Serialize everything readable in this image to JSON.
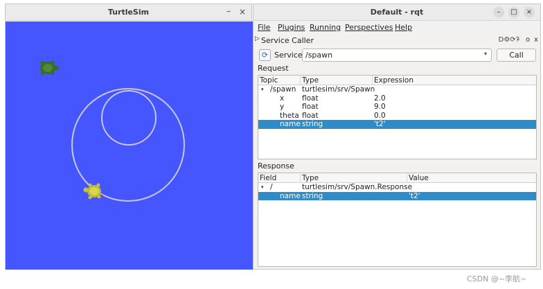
{
  "turtlesim": {
    "title": "TurtleSim",
    "minimize": "–",
    "close": "×",
    "background_color": "#4556ff",
    "pen_color": "#c8c8d8"
  },
  "rqt": {
    "title": "Default - rqt",
    "window_buttons": {
      "minimize": "–",
      "maximize": "□",
      "close": "×"
    },
    "menu": [
      "File",
      "Plugins",
      "Running",
      "Perspectives",
      "Help"
    ],
    "plugin": {
      "expand_arrow": "▷",
      "name": "Service Caller",
      "icons": "D⚙⟳?",
      "minimize": "-",
      "float": "o",
      "close": "x"
    },
    "service": {
      "refresh_icon": "⟳",
      "label": "Service",
      "value": "/spawn",
      "chevron": "▾",
      "call_label": "Call"
    },
    "request": {
      "label": "Request",
      "headers": [
        "Topic",
        "Type",
        "Expression"
      ],
      "rows": [
        {
          "topic": "/spawn",
          "type": "turtlesim/srv/Spawn",
          "expr": "",
          "expander": "▾",
          "selected": false
        },
        {
          "topic": "x",
          "type": "float",
          "expr": "2.0",
          "selected": false
        },
        {
          "topic": "y",
          "type": "float",
          "expr": "9.0",
          "selected": false
        },
        {
          "topic": "theta",
          "type": "float",
          "expr": "0.0",
          "selected": false
        },
        {
          "topic": "name",
          "type": "string",
          "expr": "'t2'",
          "selected": true
        }
      ]
    },
    "response": {
      "label": "Response",
      "headers": [
        "Field",
        "Type",
        "Value"
      ],
      "rows": [
        {
          "field": "/",
          "type": "turtlesim/srv/Spawn.Response",
          "value": "",
          "expander": "▾",
          "selected": false
        },
        {
          "field": "name",
          "type": "string",
          "value": "'t2'",
          "selected": true
        }
      ]
    },
    "selection_color": "#308cc6"
  },
  "watermark": "CSDN @~李航~"
}
